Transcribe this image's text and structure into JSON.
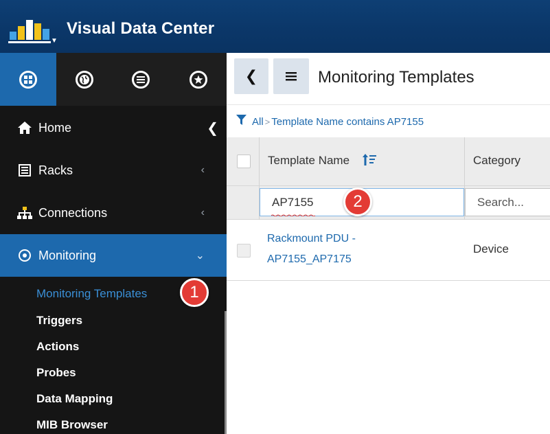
{
  "app": {
    "title": "Visual Data Center"
  },
  "colors": {
    "header": "#0b3769",
    "accent": "#1d69ad",
    "sidebar": "#151515",
    "badge": "#e33b35"
  },
  "icon_rail": [
    {
      "icon": "apps-grid-icon"
    },
    {
      "icon": "globe-icon"
    },
    {
      "icon": "list-icon"
    },
    {
      "icon": "star-icon"
    }
  ],
  "sidebar": {
    "items": [
      {
        "label": "Home",
        "icon": "home-icon"
      },
      {
        "label": "Racks",
        "icon": "rack-icon"
      },
      {
        "label": "Connections",
        "icon": "network-icon"
      },
      {
        "label": "Monitoring",
        "icon": "monitoring-icon"
      }
    ],
    "subitems": [
      {
        "label": "Monitoring Templates"
      },
      {
        "label": "Triggers"
      },
      {
        "label": "Actions"
      },
      {
        "label": "Probes"
      },
      {
        "label": "Data Mapping"
      },
      {
        "label": "MIB Browser"
      }
    ]
  },
  "main": {
    "title": "Monitoring Templates",
    "filter": {
      "all_label": "All",
      "separator": ">",
      "condition": "Template Name contains AP7155"
    },
    "columns": [
      {
        "label": "Template Name"
      },
      {
        "label": "Category"
      }
    ],
    "filter_inputs": {
      "template_name_value": "AP7155",
      "category_placeholder": "Search..."
    },
    "rows": [
      {
        "name": "Rackmount PDU - AP7155_AP7175",
        "category": "Device"
      }
    ]
  },
  "badges": {
    "step1": "1",
    "step2": "2"
  }
}
